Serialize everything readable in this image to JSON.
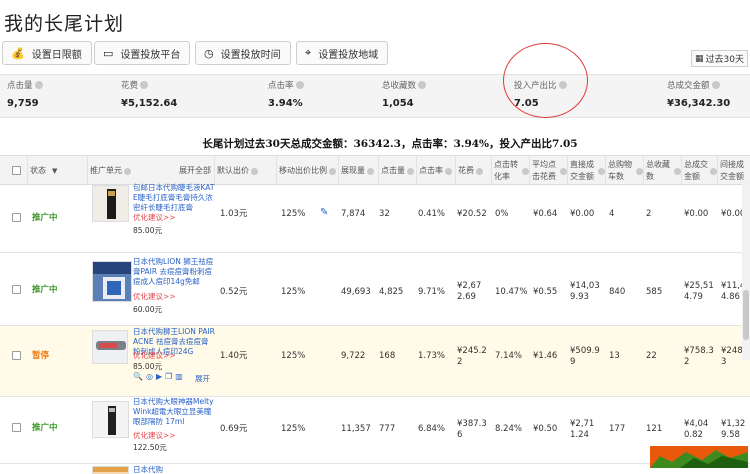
{
  "page_title": "我的长尾计划",
  "toolbar": {
    "buttons": [
      {
        "label": "设置日限额",
        "icon": "money-bag-icon"
      },
      {
        "label": "设置投放平台",
        "icon": "monitor-icon"
      },
      {
        "label": "设置投放时间",
        "icon": "clock-icon"
      },
      {
        "label": "设置投放地域",
        "icon": "map-pin-icon"
      }
    ],
    "period_label": "过去30天"
  },
  "stats": [
    {
      "label": "点击量",
      "value": "9,759"
    },
    {
      "label": "花费",
      "value": "¥5,152.64"
    },
    {
      "label": "点击率",
      "value": "3.94%"
    },
    {
      "label": "总收藏数",
      "value": "1,054"
    },
    {
      "label": "投入产出比",
      "value": "7.05"
    },
    {
      "label": "总成交金额",
      "value": "¥36,342.30"
    }
  ],
  "summary": "长尾计划过去30天总成交金额：36342.3，点击率：3.94%，投入产出比7.05",
  "table": {
    "headers": {
      "status": "状态",
      "unit": "推广单元",
      "expand_all": "展开全部",
      "default_bid": "默认出价",
      "mobile_ratio": "移动出价比例",
      "impressions": "展现量",
      "clicks": "点击量",
      "ctr": "点击率",
      "cost": "花费",
      "conv_rate": "点击转化率",
      "cpc": "平均点击花费",
      "direct_gmv": "直接成交金额",
      "cart": "总购物车数",
      "fav": "总收藏数",
      "total_gmv": "总成交金额",
      "indirect_gmv": "间接成交金额"
    },
    "optimize_label": "优化建议>>",
    "expand_label": "展开",
    "rows": [
      {
        "status": "推广中",
        "product": "包邮日本代购睫毛液KAT E睫毛打底膏毛膏持久浓密纤长睫毛打底膏",
        "price": "85.00元",
        "default_bid": "1.03元",
        "mobile_ratio": "125%",
        "impressions": "7,874",
        "clicks": "32",
        "ctr": "0.41%",
        "cost": "¥20.52",
        "conv_rate": "0%",
        "cpc": "¥0.64",
        "direct_gmv": "¥0.00",
        "cart": "4",
        "fav": "2",
        "total_gmv": "¥0.00",
        "indirect_gmv": "¥0.00"
      },
      {
        "status": "推广中",
        "product": "日本代购LION 狮王祛痘膏PAIR 去痘痘膏粉刺痘痘成人痘印14g免邮",
        "price": "60.00元",
        "default_bid": "0.52元",
        "mobile_ratio": "125%",
        "impressions": "49,693",
        "clicks": "4,825",
        "ctr": "9.71%",
        "cost": "¥2,67 2.69",
        "conv_rate": "10.47%",
        "cpc": "¥0.55",
        "direct_gmv": "¥14,03 9.93",
        "cart": "840",
        "fav": "585",
        "total_gmv": "¥25,51 4.79",
        "indirect_gmv": "¥11,47 4.86"
      },
      {
        "status": "暂停",
        "product": "日本代购狮王LION PAIR ACNE 祛痘膏去痘痘膏粉刺成人痘印24G",
        "price": "85.00元",
        "default_bid": "1.40元",
        "mobile_ratio": "125%",
        "impressions": "9,722",
        "clicks": "168",
        "ctr": "1.73%",
        "cost": "¥245.2 2",
        "conv_rate": "7.14%",
        "cpc": "¥1.46",
        "direct_gmv": "¥509.9 9",
        "cart": "13",
        "fav": "22",
        "total_gmv": "¥758.3 2",
        "indirect_gmv": "¥248.3 3"
      },
      {
        "status": "推广中",
        "product": "日本代购大眼神器Melty Wink超電大眼立显美瞳眼部隔防 17ml",
        "price": "122.50元",
        "default_bid": "0.69元",
        "mobile_ratio": "125%",
        "impressions": "11,357",
        "clicks": "777",
        "ctr": "6.84%",
        "cost": "¥387.3 6",
        "conv_rate": "8.24%",
        "cpc": "¥0.50",
        "direct_gmv": "¥2,71 1.24",
        "cart": "177",
        "fav": "121",
        "total_gmv": "¥4,04 0.82",
        "indirect_gmv": "¥1,32 9.58"
      },
      {
        "product": "日本代购CANMAKEbaby"
      }
    ]
  }
}
